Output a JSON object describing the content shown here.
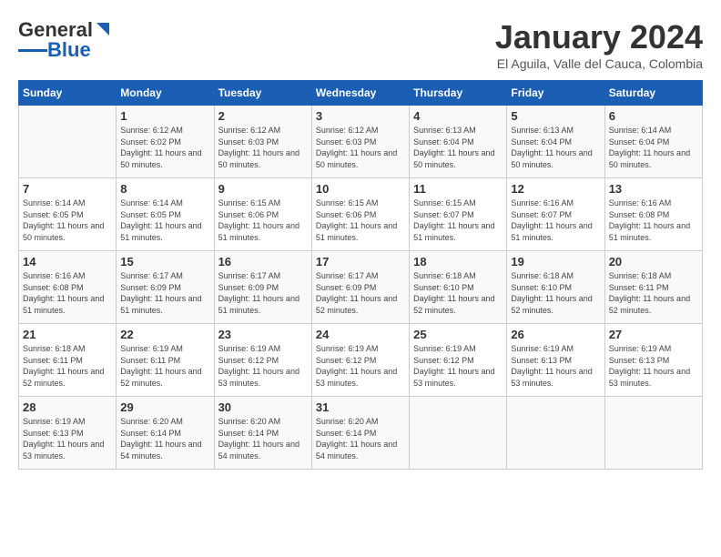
{
  "header": {
    "logo_general": "General",
    "logo_blue": "Blue",
    "month_title": "January 2024",
    "location": "El Aguila, Valle del Cauca, Colombia"
  },
  "days_of_week": [
    "Sunday",
    "Monday",
    "Tuesday",
    "Wednesday",
    "Thursday",
    "Friday",
    "Saturday"
  ],
  "weeks": [
    [
      {
        "day": "",
        "sunrise": "",
        "sunset": "",
        "daylight": ""
      },
      {
        "day": "1",
        "sunrise": "Sunrise: 6:12 AM",
        "sunset": "Sunset: 6:02 PM",
        "daylight": "Daylight: 11 hours and 50 minutes."
      },
      {
        "day": "2",
        "sunrise": "Sunrise: 6:12 AM",
        "sunset": "Sunset: 6:03 PM",
        "daylight": "Daylight: 11 hours and 50 minutes."
      },
      {
        "day": "3",
        "sunrise": "Sunrise: 6:12 AM",
        "sunset": "Sunset: 6:03 PM",
        "daylight": "Daylight: 11 hours and 50 minutes."
      },
      {
        "day": "4",
        "sunrise": "Sunrise: 6:13 AM",
        "sunset": "Sunset: 6:04 PM",
        "daylight": "Daylight: 11 hours and 50 minutes."
      },
      {
        "day": "5",
        "sunrise": "Sunrise: 6:13 AM",
        "sunset": "Sunset: 6:04 PM",
        "daylight": "Daylight: 11 hours and 50 minutes."
      },
      {
        "day": "6",
        "sunrise": "Sunrise: 6:14 AM",
        "sunset": "Sunset: 6:04 PM",
        "daylight": "Daylight: 11 hours and 50 minutes."
      }
    ],
    [
      {
        "day": "7",
        "sunrise": "Sunrise: 6:14 AM",
        "sunset": "Sunset: 6:05 PM",
        "daylight": "Daylight: 11 hours and 50 minutes."
      },
      {
        "day": "8",
        "sunrise": "Sunrise: 6:14 AM",
        "sunset": "Sunset: 6:05 PM",
        "daylight": "Daylight: 11 hours and 51 minutes."
      },
      {
        "day": "9",
        "sunrise": "Sunrise: 6:15 AM",
        "sunset": "Sunset: 6:06 PM",
        "daylight": "Daylight: 11 hours and 51 minutes."
      },
      {
        "day": "10",
        "sunrise": "Sunrise: 6:15 AM",
        "sunset": "Sunset: 6:06 PM",
        "daylight": "Daylight: 11 hours and 51 minutes."
      },
      {
        "day": "11",
        "sunrise": "Sunrise: 6:15 AM",
        "sunset": "Sunset: 6:07 PM",
        "daylight": "Daylight: 11 hours and 51 minutes."
      },
      {
        "day": "12",
        "sunrise": "Sunrise: 6:16 AM",
        "sunset": "Sunset: 6:07 PM",
        "daylight": "Daylight: 11 hours and 51 minutes."
      },
      {
        "day": "13",
        "sunrise": "Sunrise: 6:16 AM",
        "sunset": "Sunset: 6:08 PM",
        "daylight": "Daylight: 11 hours and 51 minutes."
      }
    ],
    [
      {
        "day": "14",
        "sunrise": "Sunrise: 6:16 AM",
        "sunset": "Sunset: 6:08 PM",
        "daylight": "Daylight: 11 hours and 51 minutes."
      },
      {
        "day": "15",
        "sunrise": "Sunrise: 6:17 AM",
        "sunset": "Sunset: 6:09 PM",
        "daylight": "Daylight: 11 hours and 51 minutes."
      },
      {
        "day": "16",
        "sunrise": "Sunrise: 6:17 AM",
        "sunset": "Sunset: 6:09 PM",
        "daylight": "Daylight: 11 hours and 51 minutes."
      },
      {
        "day": "17",
        "sunrise": "Sunrise: 6:17 AM",
        "sunset": "Sunset: 6:09 PM",
        "daylight": "Daylight: 11 hours and 52 minutes."
      },
      {
        "day": "18",
        "sunrise": "Sunrise: 6:18 AM",
        "sunset": "Sunset: 6:10 PM",
        "daylight": "Daylight: 11 hours and 52 minutes."
      },
      {
        "day": "19",
        "sunrise": "Sunrise: 6:18 AM",
        "sunset": "Sunset: 6:10 PM",
        "daylight": "Daylight: 11 hours and 52 minutes."
      },
      {
        "day": "20",
        "sunrise": "Sunrise: 6:18 AM",
        "sunset": "Sunset: 6:11 PM",
        "daylight": "Daylight: 11 hours and 52 minutes."
      }
    ],
    [
      {
        "day": "21",
        "sunrise": "Sunrise: 6:18 AM",
        "sunset": "Sunset: 6:11 PM",
        "daylight": "Daylight: 11 hours and 52 minutes."
      },
      {
        "day": "22",
        "sunrise": "Sunrise: 6:19 AM",
        "sunset": "Sunset: 6:11 PM",
        "daylight": "Daylight: 11 hours and 52 minutes."
      },
      {
        "day": "23",
        "sunrise": "Sunrise: 6:19 AM",
        "sunset": "Sunset: 6:12 PM",
        "daylight": "Daylight: 11 hours and 53 minutes."
      },
      {
        "day": "24",
        "sunrise": "Sunrise: 6:19 AM",
        "sunset": "Sunset: 6:12 PM",
        "daylight": "Daylight: 11 hours and 53 minutes."
      },
      {
        "day": "25",
        "sunrise": "Sunrise: 6:19 AM",
        "sunset": "Sunset: 6:12 PM",
        "daylight": "Daylight: 11 hours and 53 minutes."
      },
      {
        "day": "26",
        "sunrise": "Sunrise: 6:19 AM",
        "sunset": "Sunset: 6:13 PM",
        "daylight": "Daylight: 11 hours and 53 minutes."
      },
      {
        "day": "27",
        "sunrise": "Sunrise: 6:19 AM",
        "sunset": "Sunset: 6:13 PM",
        "daylight": "Daylight: 11 hours and 53 minutes."
      }
    ],
    [
      {
        "day": "28",
        "sunrise": "Sunrise: 6:19 AM",
        "sunset": "Sunset: 6:13 PM",
        "daylight": "Daylight: 11 hours and 53 minutes."
      },
      {
        "day": "29",
        "sunrise": "Sunrise: 6:20 AM",
        "sunset": "Sunset: 6:14 PM",
        "daylight": "Daylight: 11 hours and 54 minutes."
      },
      {
        "day": "30",
        "sunrise": "Sunrise: 6:20 AM",
        "sunset": "Sunset: 6:14 PM",
        "daylight": "Daylight: 11 hours and 54 minutes."
      },
      {
        "day": "31",
        "sunrise": "Sunrise: 6:20 AM",
        "sunset": "Sunset: 6:14 PM",
        "daylight": "Daylight: 11 hours and 54 minutes."
      },
      {
        "day": "",
        "sunrise": "",
        "sunset": "",
        "daylight": ""
      },
      {
        "day": "",
        "sunrise": "",
        "sunset": "",
        "daylight": ""
      },
      {
        "day": "",
        "sunrise": "",
        "sunset": "",
        "daylight": ""
      }
    ]
  ]
}
